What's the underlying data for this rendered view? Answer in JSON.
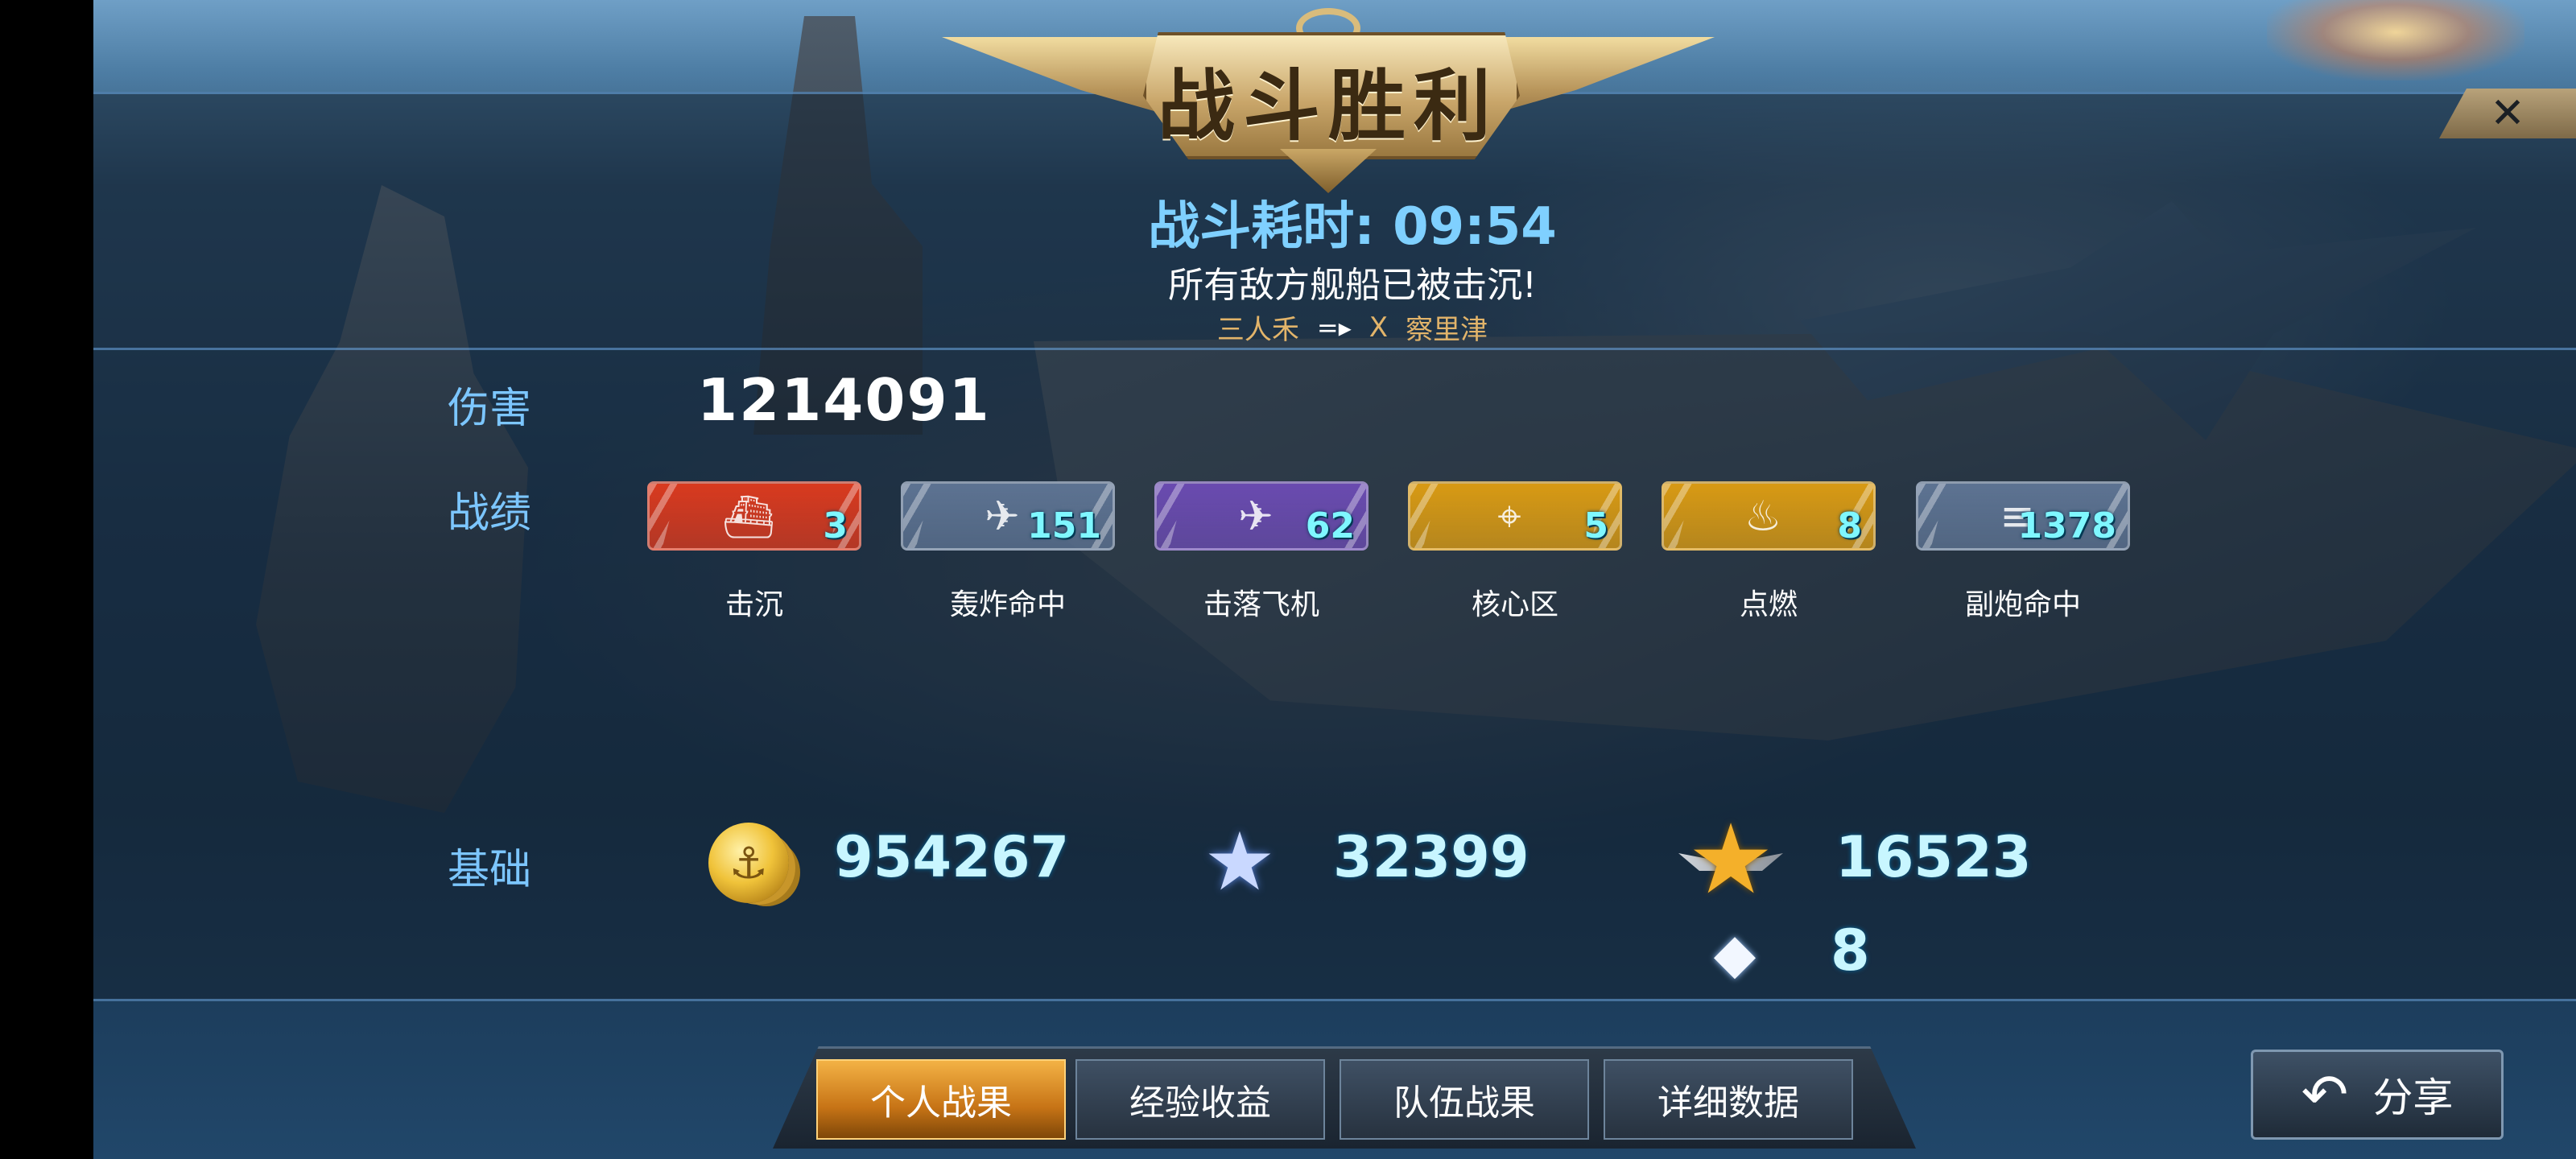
{
  "header": {
    "title": "战斗胜利",
    "close_symbol": "✕",
    "battle_time_label": "战斗耗时:",
    "battle_time_value": "09:54",
    "result_text": "所有敌方舰船已被击沉!",
    "kill_feed": {
      "killer": "三人禾",
      "arrow": "=▸",
      "mark": "X",
      "victim": "察里津"
    }
  },
  "damage": {
    "label": "伤害",
    "value": "1214091"
  },
  "records": {
    "label": "战绩",
    "items": [
      {
        "label": "击沉",
        "count": "3",
        "icon": "ship-sunk-icon",
        "color": "#d93a1f"
      },
      {
        "label": "轰炸命中",
        "count": "151",
        "icon": "bomber-icon",
        "color": "#5d7392"
      },
      {
        "label": "击落飞机",
        "count": "62",
        "icon": "plane-shotdown-icon",
        "color": "#6a4bb0"
      },
      {
        "label": "核心区",
        "count": "5",
        "icon": "crosshair-icon",
        "color": "#d89a14"
      },
      {
        "label": "点燃",
        "count": "8",
        "icon": "fire-icon",
        "color": "#d89a14"
      },
      {
        "label": "副炮命中",
        "count": "1378",
        "icon": "secondary-gun-icon",
        "color": "#5d7392"
      }
    ]
  },
  "base": {
    "label": "基础",
    "coins": "954267",
    "silver_stars": "32399",
    "gold_stars": "16523",
    "diamonds": "8"
  },
  "tabs": [
    {
      "label": "个人战果",
      "active": true
    },
    {
      "label": "经验收益",
      "active": false
    },
    {
      "label": "队伍战果",
      "active": false
    },
    {
      "label": "详细数据",
      "active": false
    }
  ],
  "share": {
    "label": "分享"
  }
}
